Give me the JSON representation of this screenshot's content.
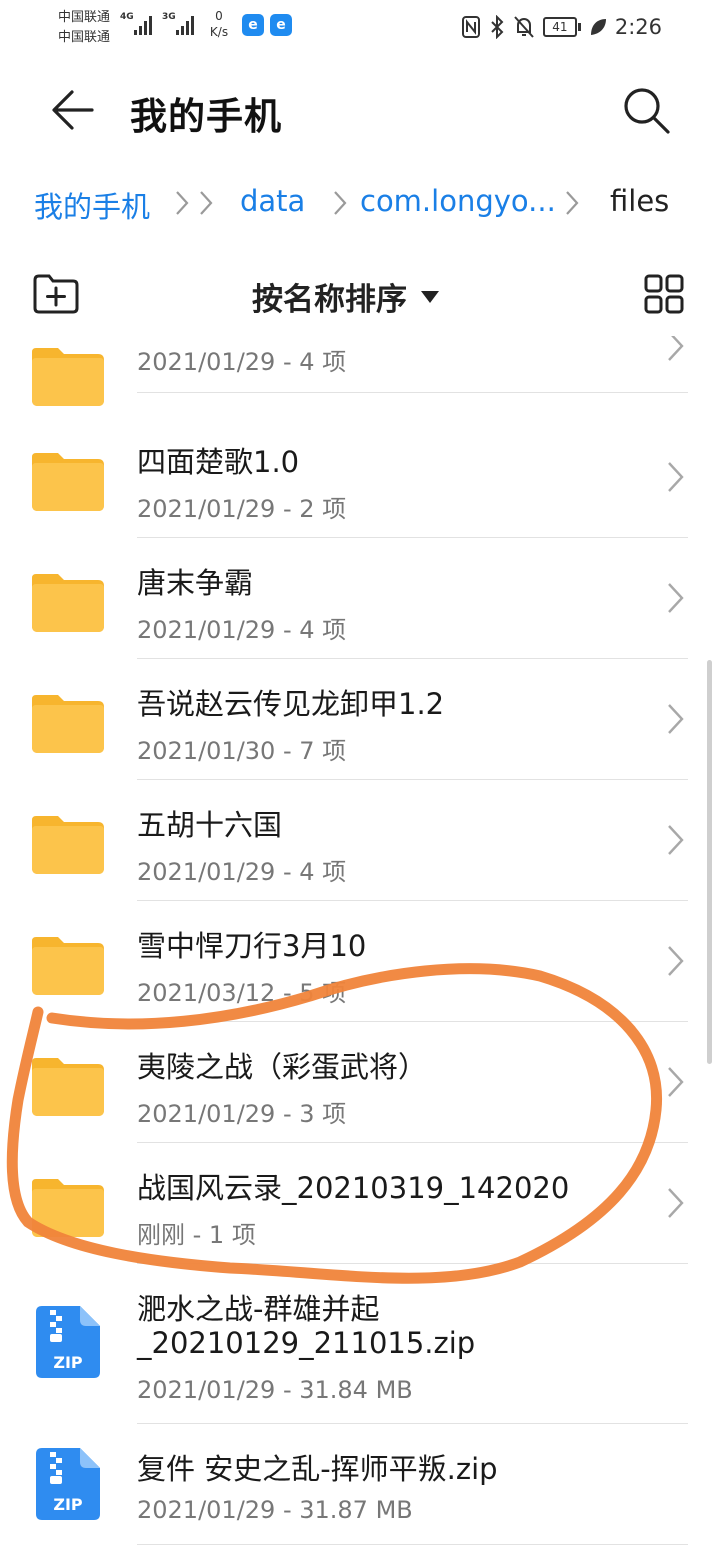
{
  "status_bar": {
    "carrier_1": "中国联通",
    "carrier_2": "中国联通",
    "net_1": "4G",
    "net_2": "3G",
    "speed_value": "0",
    "speed_unit": "K/s",
    "app_badge": "e",
    "battery": "41",
    "time": "2:26"
  },
  "header": {
    "title": "我的手机"
  },
  "breadcrumb": [
    {
      "label": "我的手机"
    },
    {
      "label": "data"
    },
    {
      "label": "com.longyo..."
    },
    {
      "label": "files"
    }
  ],
  "toolbar": {
    "sort_label": "按名称排序"
  },
  "files": [
    {
      "name": "",
      "meta": "2021/01/29 - 4 项",
      "type": "folder"
    },
    {
      "name": "四面楚歌1.0",
      "meta": "2021/01/29 - 2 项",
      "type": "folder"
    },
    {
      "name": "唐末争霸",
      "meta": "2021/01/29 - 4 项",
      "type": "folder"
    },
    {
      "name": "吾说赵云传见龙卸甲1.2",
      "meta": "2021/01/30 - 7 项",
      "type": "folder"
    },
    {
      "name": "五胡十六国",
      "meta": "2021/01/29 - 4 项",
      "type": "folder"
    },
    {
      "name": "雪中悍刀行3月10",
      "meta": "2021/03/12 - 5 项",
      "type": "folder"
    },
    {
      "name": "夷陵之战（彩蛋武将）",
      "meta": "2021/01/29 - 3 项",
      "type": "folder"
    },
    {
      "name": "战国风云录_20210319_142020",
      "meta": "刚刚 - 1 项",
      "type": "folder"
    },
    {
      "name": "淝水之战-群雄并起",
      "name_2": "_20210129_211015.zip",
      "meta": "2021/01/29 - 31.84 MB",
      "type": "zip",
      "icon_label": "ZIP"
    },
    {
      "name": "复件 安史之乱-挥师平叛.zip",
      "meta": "2021/01/29 - 31.87 MB",
      "type": "zip",
      "icon_label": "ZIP"
    }
  ],
  "colors": {
    "accent": "#1a7fe6",
    "folder": "#fcc44b",
    "folder_tab": "#f7b52e",
    "zip": "#2f8cf0",
    "annotation": "#f0843a"
  }
}
